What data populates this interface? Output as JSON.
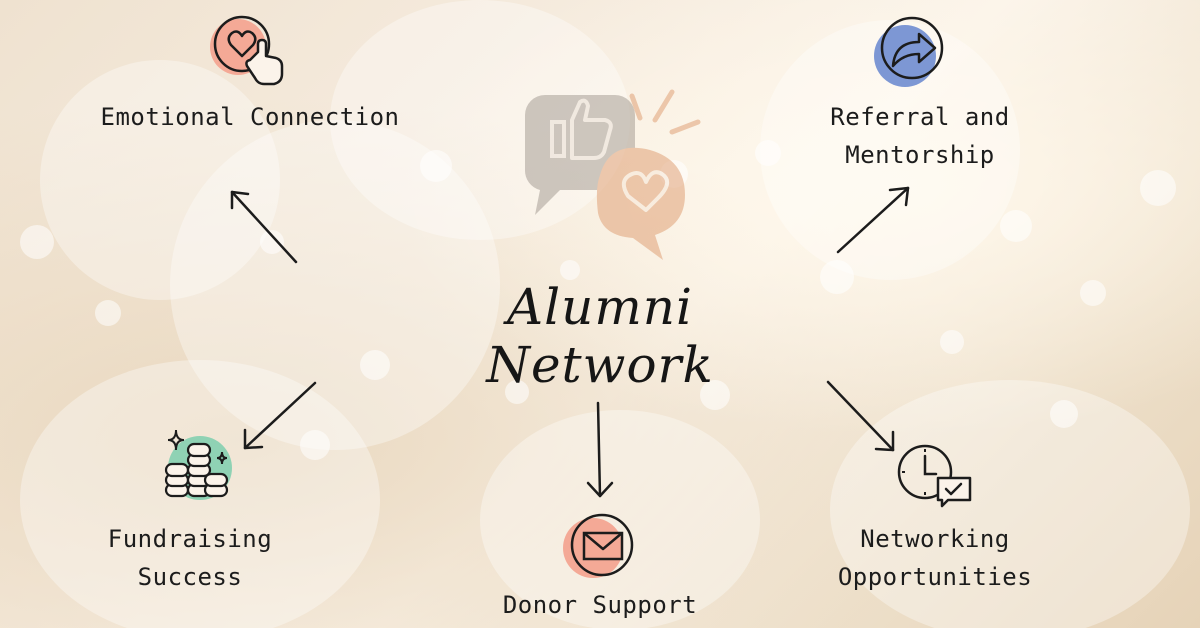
{
  "title": "Alumni Network",
  "nodes": {
    "emotional": {
      "label": "Emotional Connection",
      "icon": "heart-click-icon"
    },
    "referral": {
      "label": "Referral and\nMentorship",
      "icon": "share-arrow-icon"
    },
    "fundraising": {
      "label": "Fundraising\nSuccess",
      "icon": "coin-stacks-icon"
    },
    "donor": {
      "label": "Donor Support",
      "icon": "envelope-icon"
    },
    "networking": {
      "label": "Networking\nOpportunities",
      "icon": "clock-chat-icon"
    }
  },
  "center_graphic": {
    "icon": "thumbs-up-heart-speech-bubbles-icon"
  },
  "colors": {
    "coral": "#f4a996",
    "blue": "#7d97d4",
    "green": "#8fd2b4",
    "ink": "#1c1c1c"
  }
}
